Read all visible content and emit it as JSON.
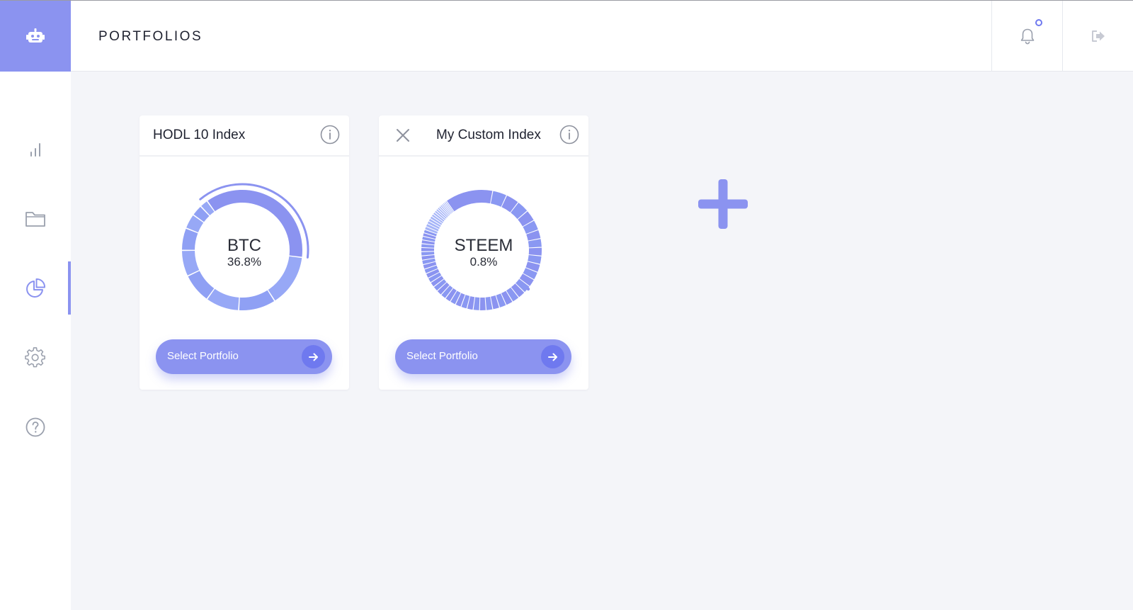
{
  "header": {
    "title": "PORTFOLIOS",
    "logo_icon": "robot-icon",
    "notification_icon": "bell-icon",
    "logout_icon": "logout-icon"
  },
  "sidebar": {
    "items": [
      {
        "icon": "bar-chart-icon",
        "active": false
      },
      {
        "icon": "folder-icon",
        "active": false
      },
      {
        "icon": "pie-chart-icon",
        "active": true
      },
      {
        "icon": "gear-icon",
        "active": false
      },
      {
        "icon": "help-icon",
        "active": false
      }
    ]
  },
  "portfolios": [
    {
      "title": "HODL 10 Index",
      "closable": false,
      "highlight_symbol": "BTC",
      "highlight_percent": "36.8%",
      "button_label": "Select Portfolio"
    },
    {
      "title": "My Custom Index",
      "closable": true,
      "highlight_symbol": "STEEM",
      "highlight_percent": "0.8%",
      "button_label": "Select Portfolio"
    }
  ],
  "add_portfolio_icon": "plus-icon",
  "colors": {
    "accent": "#8b93f0",
    "accent_dark": "#6f79ef",
    "accent_light": "#97a8f6",
    "background": "#f4f5f9"
  },
  "chart_data": [
    {
      "type": "pie",
      "title": "HODL 10 Index",
      "center_label": "BTC",
      "center_value": "36.8%",
      "highlighted_slice": 0,
      "values": [
        36.8,
        14,
        10,
        9,
        8,
        7,
        6,
        4,
        3,
        2.2
      ]
    },
    {
      "type": "pie",
      "title": "My Custom Index",
      "center_label": "STEEM",
      "center_value": "0.8%",
      "segments_approx": 60
    }
  ]
}
